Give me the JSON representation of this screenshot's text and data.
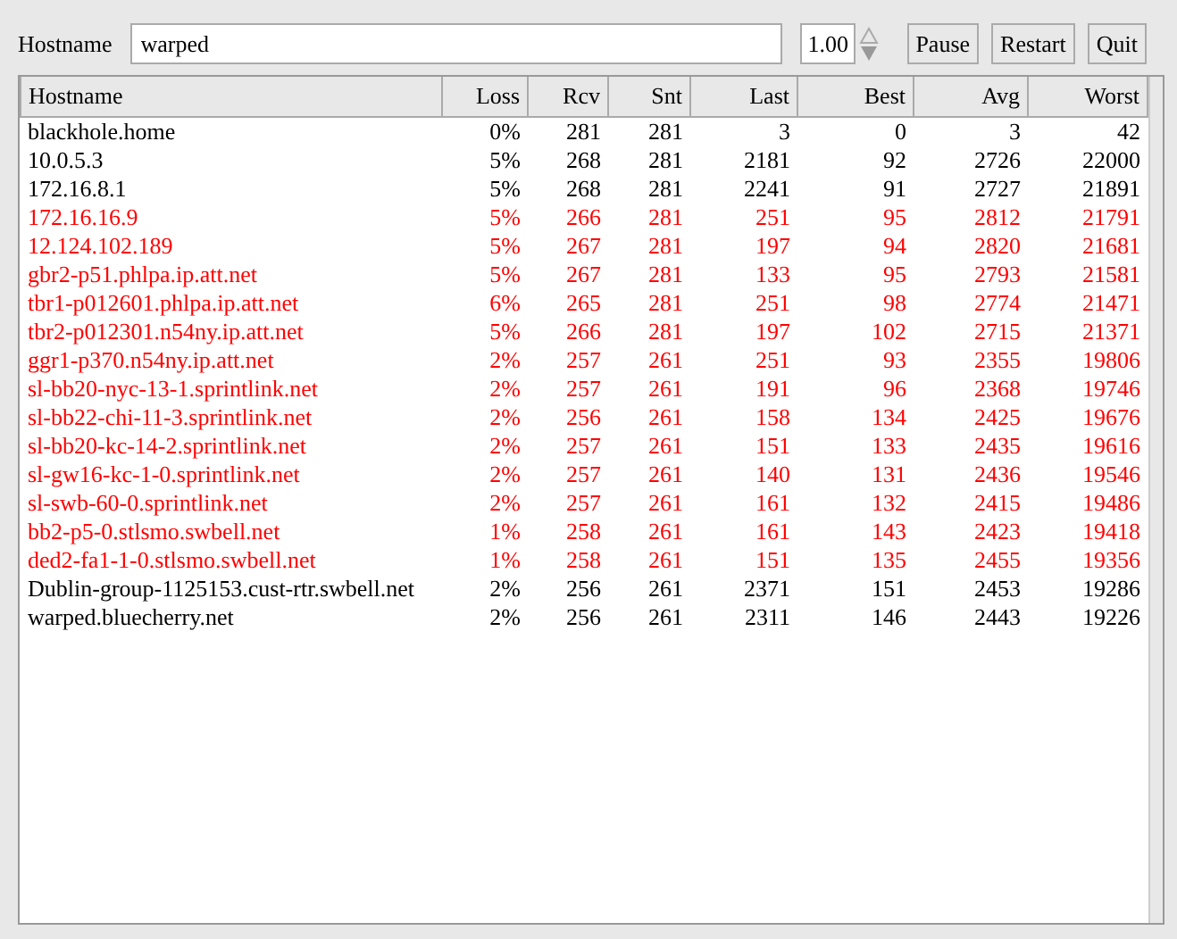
{
  "toolbar": {
    "hostname_label": "Hostname",
    "hostname_value": "warped",
    "interval_value": "1.00",
    "buttons": [
      "Pause",
      "Restart",
      "Quit"
    ]
  },
  "table": {
    "columns": [
      "Hostname",
      "Loss",
      "Rcv",
      "Snt",
      "Last",
      "Best",
      "Avg",
      "Worst"
    ],
    "rows": [
      {
        "color": "#000000",
        "cells": [
          "blackhole.home",
          "0%",
          "281",
          "281",
          "3",
          "0",
          "3",
          "42"
        ]
      },
      {
        "color": "#000000",
        "cells": [
          "10.0.5.3",
          "5%",
          "268",
          "281",
          "2181",
          "92",
          "2726",
          "22000"
        ]
      },
      {
        "color": "#000000",
        "cells": [
          "172.16.8.1",
          "5%",
          "268",
          "281",
          "2241",
          "91",
          "2727",
          "21891"
        ]
      },
      {
        "color": "#ff0000",
        "cells": [
          "172.16.16.9",
          "5%",
          "266",
          "281",
          "251",
          "95",
          "2812",
          "21791"
        ]
      },
      {
        "color": "#ff0000",
        "cells": [
          "12.124.102.189",
          "5%",
          "267",
          "281",
          "197",
          "94",
          "2820",
          "21681"
        ]
      },
      {
        "color": "#ff0000",
        "cells": [
          "gbr2-p51.phlpa.ip.att.net",
          "5%",
          "267",
          "281",
          "133",
          "95",
          "2793",
          "21581"
        ]
      },
      {
        "color": "#ff0000",
        "cells": [
          "tbr1-p012601.phlpa.ip.att.net",
          "6%",
          "265",
          "281",
          "251",
          "98",
          "2774",
          "21471"
        ]
      },
      {
        "color": "#ff0000",
        "cells": [
          "tbr2-p012301.n54ny.ip.att.net",
          "5%",
          "266",
          "281",
          "197",
          "102",
          "2715",
          "21371"
        ]
      },
      {
        "color": "#ff0000",
        "cells": [
          "ggr1-p370.n54ny.ip.att.net",
          "2%",
          "257",
          "261",
          "251",
          "93",
          "2355",
          "19806"
        ]
      },
      {
        "color": "#ff0000",
        "cells": [
          "sl-bb20-nyc-13-1.sprintlink.net",
          "2%",
          "257",
          "261",
          "191",
          "96",
          "2368",
          "19746"
        ]
      },
      {
        "color": "#ff0000",
        "cells": [
          "sl-bb22-chi-11-3.sprintlink.net",
          "2%",
          "256",
          "261",
          "158",
          "134",
          "2425",
          "19676"
        ]
      },
      {
        "color": "#ff0000",
        "cells": [
          "sl-bb20-kc-14-2.sprintlink.net",
          "2%",
          "257",
          "261",
          "151",
          "133",
          "2435",
          "19616"
        ]
      },
      {
        "color": "#ff0000",
        "cells": [
          "sl-gw16-kc-1-0.sprintlink.net",
          "2%",
          "257",
          "261",
          "140",
          "131",
          "2436",
          "19546"
        ]
      },
      {
        "color": "#ff0000",
        "cells": [
          "sl-swb-60-0.sprintlink.net",
          "2%",
          "257",
          "261",
          "161",
          "132",
          "2415",
          "19486"
        ]
      },
      {
        "color": "#ff0000",
        "cells": [
          "bb2-p5-0.stlsmo.swbell.net",
          "1%",
          "258",
          "261",
          "161",
          "143",
          "2423",
          "19418"
        ]
      },
      {
        "color": "#ff0000",
        "cells": [
          "ded2-fa1-1-0.stlsmo.swbell.net",
          "1%",
          "258",
          "261",
          "151",
          "135",
          "2455",
          "19356"
        ]
      },
      {
        "color": "#000000",
        "cells": [
          "Dublin-group-1125153.cust-rtr.swbell.net",
          "2%",
          "256",
          "261",
          "2371",
          "151",
          "2453",
          "19286"
        ]
      },
      {
        "color": "#000000",
        "cells": [
          "warped.bluecherry.net",
          "2%",
          "256",
          "261",
          "2311",
          "146",
          "2443",
          "19226"
        ]
      }
    ]
  }
}
